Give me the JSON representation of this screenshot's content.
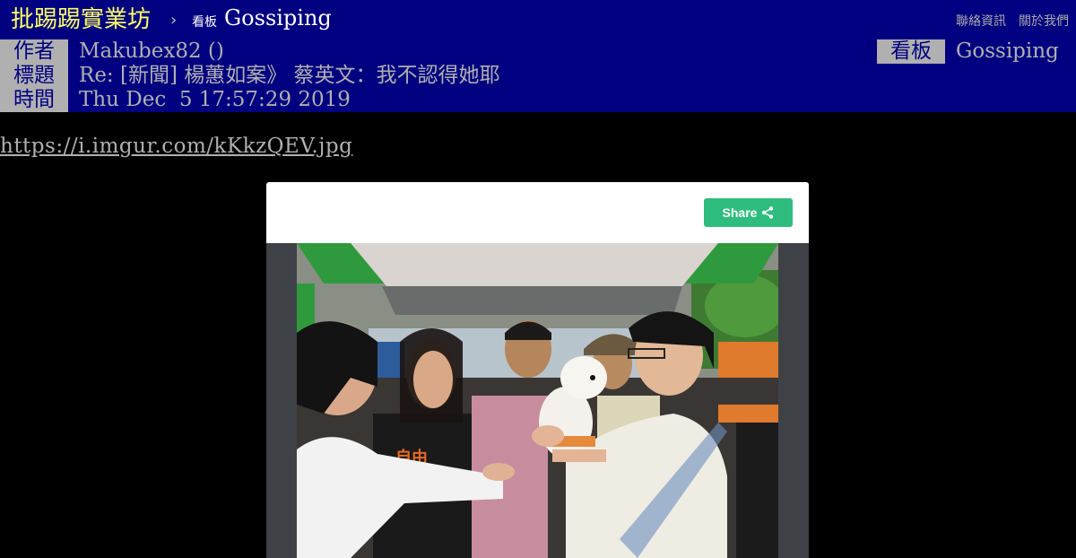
{
  "nav": {
    "site_name": "批踢踢實業坊",
    "separator": "›",
    "board_label": "看板",
    "board_name": "Gossiping",
    "links": [
      "聯絡資訊",
      "關於我們"
    ]
  },
  "header": {
    "author_tag": "作者",
    "author": "Makubex82 ()",
    "title_tag": "標題",
    "title": "Re: [新聞] 楊蕙如案》 蔡英文：我不認得她耶",
    "time_tag": "時間",
    "time": "Thu Dec  5 17:57:29 2019",
    "board_tag": "看板",
    "board": "Gossiping"
  },
  "post": {
    "link": "https://i.imgur.com/kKkzQEV.jpg"
  },
  "embed": {
    "share_label": "Share",
    "share_icon": "share-icon"
  },
  "colors": {
    "nav_bg": "#000080",
    "site_name": "#ffff66",
    "meta_tag_bg": "#b0b0b0",
    "share_button": "#2ebd7e"
  }
}
